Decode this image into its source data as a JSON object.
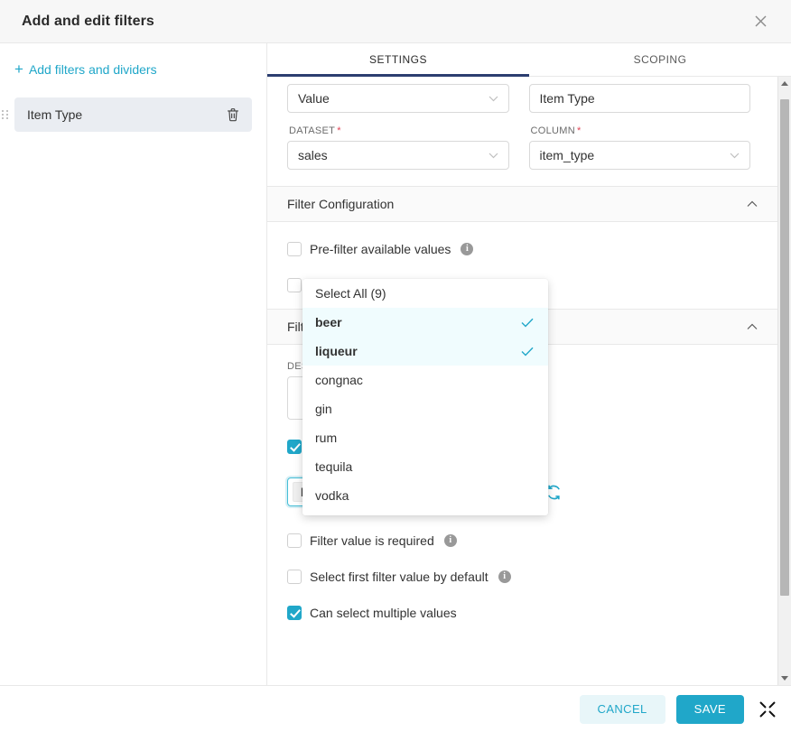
{
  "header": {
    "title": "Add and edit filters",
    "close_icon": "close-icon"
  },
  "sidebar": {
    "add_link": "Add filters and dividers",
    "add_icon": "plus-icon",
    "items": [
      {
        "label": "Item Type",
        "delete_icon": "trash-icon",
        "drag_icon": "drag-handle-icon"
      }
    ]
  },
  "tabs": [
    {
      "label": "SETTINGS",
      "active": true
    },
    {
      "label": "SCOPING",
      "active": false
    }
  ],
  "form": {
    "filter_type": {
      "value": "Value",
      "caret_icon": "chevron-down-icon"
    },
    "filter_name": {
      "value": "Item Type"
    },
    "dataset": {
      "label": "DATASET",
      "required": "*",
      "value": "sales",
      "caret_icon": "chevron-down-icon"
    },
    "column": {
      "label": "COLUMN",
      "required": "*",
      "value": "item_type",
      "caret_icon": "chevron-down-icon"
    }
  },
  "filter_configuration": {
    "title": "Filter Configuration",
    "collapse_icon": "chevron-up-icon",
    "checkboxes": [
      {
        "label": "Pre-filter available values",
        "checked": false,
        "info_icon": "info-icon",
        "info_char": "i"
      },
      {
        "label": "",
        "checked": false,
        "info_icon": "",
        "info_char": ""
      }
    ]
  },
  "filter_settings": {
    "title": "Filter Settings",
    "title_visible": "Filte",
    "collapse_icon": "chevron-up-icon",
    "description_label": "DESCRIPTION",
    "description_label_visible": "DES",
    "description_value": "",
    "tag_input": {
      "tags": [
        "beer",
        "liqueur"
      ],
      "tag_remove_icon": "close-small-icon",
      "clear_icon": "clear-circle-icon",
      "clear_char": "×",
      "refresh_icon": "refresh-icon"
    },
    "checkboxes": [
      {
        "label": "Filter value is required",
        "checked": false,
        "info_icon": "info-icon",
        "info_char": "i"
      },
      {
        "label": "Select first filter value by default",
        "checked": false,
        "info_icon": "info-icon",
        "info_char": "i"
      },
      {
        "label": "Can select multiple values",
        "checked": true,
        "info_icon": "",
        "info_char": ""
      }
    ]
  },
  "dropdown": {
    "select_all": "Select All (9)",
    "check_icon": "check-icon",
    "options": [
      {
        "label": "beer",
        "selected": true
      },
      {
        "label": "liqueur",
        "selected": true
      },
      {
        "label": "congnac",
        "selected": false
      },
      {
        "label": "gin",
        "selected": false
      },
      {
        "label": "rum",
        "selected": false
      },
      {
        "label": "tequila",
        "selected": false
      },
      {
        "label": "vodka",
        "selected": false
      }
    ]
  },
  "scrollbar": {
    "up_icon": "caret-up-icon",
    "down_icon": "caret-down-icon"
  },
  "footer": {
    "cancel_label": "CANCEL",
    "save_label": "SAVE",
    "resize_icon": "collapse-arrows-icon"
  },
  "colors": {
    "accent": "#20a7c9",
    "active_tab_underline": "#2c3e70",
    "required_asterisk": "#e04355",
    "selected_row_bg": "#f0fcfe",
    "sidebar_item_bg": "#eaedf2"
  }
}
